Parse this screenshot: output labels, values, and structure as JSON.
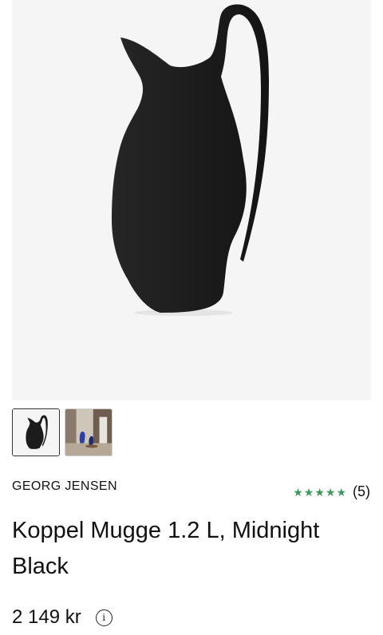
{
  "product": {
    "brand": "GEORG JENSEN",
    "title": "Koppel Mugge 1.2 L, Midnight Black",
    "price": "2 149 kr",
    "rating": {
      "stars": 5,
      "count_label": "(5)",
      "star_color": "#3a9a5b"
    }
  },
  "gallery": {
    "active_index": 0,
    "thumbnails": [
      "black-pitcher-thumbnail",
      "interior-scene-thumbnail"
    ]
  },
  "icons": {
    "info": "info-icon",
    "star": "star-icon"
  },
  "colors": {
    "pitcher": "#1c1c1c",
    "hero_background": "#f5f5f5",
    "text": "#111111"
  }
}
